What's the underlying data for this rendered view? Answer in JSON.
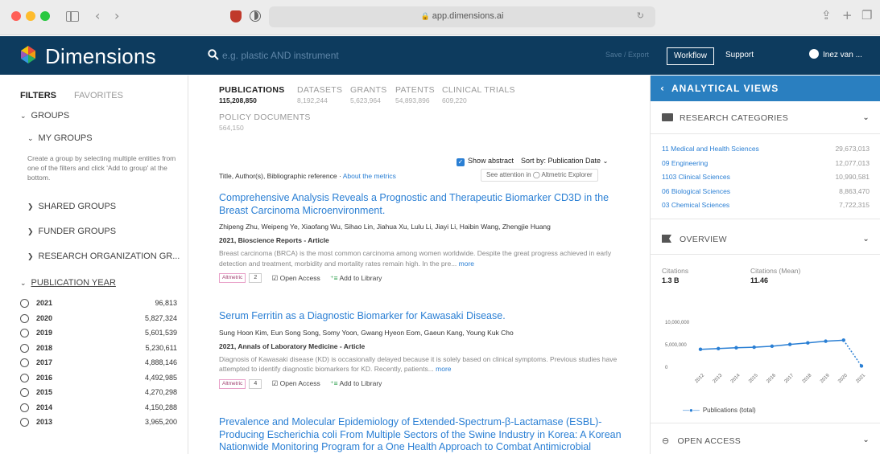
{
  "browser": {
    "url": "app.dimensions.ai",
    "nav_back": "‹",
    "nav_forward": "›"
  },
  "header": {
    "brand": "Dimensions",
    "search_placeholder": "e.g. plastic AND instrument",
    "save_export": "Save / Export",
    "workflow": "Workflow",
    "support": "Support",
    "user": "Inez van ..."
  },
  "filters": {
    "tab_filters": "FILTERS",
    "tab_favorites": "FAVORITES",
    "groups": "GROUPS",
    "my_groups": "MY GROUPS",
    "my_groups_help": "Create a group by selecting multiple entities from one of the filters and click 'Add to group' at the bottom.",
    "shared_groups": "SHARED GROUPS",
    "funder_groups": "FUNDER GROUPS",
    "research_org_groups": "RESEARCH ORGANIZATION GR...",
    "publication_year": "PUBLICATION YEAR",
    "years": [
      {
        "year": "2021",
        "count": "96,813"
      },
      {
        "year": "2020",
        "count": "5,827,324"
      },
      {
        "year": "2019",
        "count": "5,601,539"
      },
      {
        "year": "2018",
        "count": "5,230,611"
      },
      {
        "year": "2017",
        "count": "4,888,146"
      },
      {
        "year": "2016",
        "count": "4,492,985"
      },
      {
        "year": "2015",
        "count": "4,270,298"
      },
      {
        "year": "2014",
        "count": "4,150,288"
      },
      {
        "year": "2013",
        "count": "3,965,200"
      }
    ]
  },
  "results": {
    "tabs": [
      {
        "label": "PUBLICATIONS",
        "count": "115,208,850"
      },
      {
        "label": "DATASETS",
        "count": "8,192,244"
      },
      {
        "label": "GRANTS",
        "count": "5,623,964"
      },
      {
        "label": "PATENTS",
        "count": "54,893,896"
      },
      {
        "label": "CLINICAL TRIALS",
        "count": "609,220"
      }
    ],
    "policy_label": "POLICY DOCUMENTS",
    "policy_count": "564,150",
    "show_abstract": "Show abstract",
    "sort_by": "Sort by: Publication Date",
    "meta_prefix": "Title, Author(s), Bibliographic reference · ",
    "meta_link": "About the metrics",
    "attention_btn": "See attention in ◯ Altmetric Explorer",
    "open_access": "Open Access",
    "add_library": "Add to Library",
    "more": "more",
    "altmetric": "Altmetric",
    "publications": [
      {
        "title": "Comprehensive Analysis Reveals a Prognostic and Therapeutic Biomarker CD3D in the Breast Carcinoma Microenvironment.",
        "authors": "Zhipeng Zhu, Weipeng Ye, Xiaofang Wu, Sihao Lin, Jiahua Xu, Lulu Li, Jiayi Li, Haibin Wang, Zhengjie Huang",
        "source": "2021, Bioscience Reports - Article",
        "abstract": "Breast carcinoma (BRCA) is the most common carcinoma among women worldwide. Despite the great progress achieved in early detection and treatment, morbidity and mortality rates remain high. In the pre...",
        "citations": "2"
      },
      {
        "title": "Serum Ferritin as a Diagnostic Biomarker for Kawasaki Disease.",
        "authors": "Sung Hoon Kim, Eun Song Song, Somy Yoon, Gwang Hyeon Eom, Gaeun Kang, Young Kuk Cho",
        "source": "2021, Annals of Laboratory Medicine - Article",
        "abstract": "Diagnosis of Kawasaki disease (KD) is occasionally delayed because it is solely based on clinical symptoms. Previous studies have attempted to identify diagnostic biomarkers for KD. Recently, patients...",
        "citations": "4"
      },
      {
        "title": "Prevalence and Molecular Epidemiology of Extended-Spectrum-β-Lactamase (ESBL)-Producing Escherichia coli From Multiple Sectors of the Swine Industry in Korea: A Korean Nationwide Monitoring Program for a One Health Approach to Combat Antimicrobial"
      }
    ]
  },
  "analytics": {
    "title": "ANALYTICAL VIEWS",
    "research_categories": "RESEARCH CATEGORIES",
    "categories": [
      {
        "name": "11 Medical and Health Sciences",
        "value": "29,673,013"
      },
      {
        "name": "09 Engineering",
        "value": "12,077,013"
      },
      {
        "name": "1103 Clinical Sciences",
        "value": "10,990,581"
      },
      {
        "name": "06 Biological Sciences",
        "value": "8,863,470"
      },
      {
        "name": "03 Chemical Sciences",
        "value": "7,722,315"
      }
    ],
    "overview": "OVERVIEW",
    "citations_label": "Citations",
    "citations_value": "1.3 B",
    "citations_mean_label": "Citations (Mean)",
    "citations_mean_value": "11.46",
    "open_access": "OPEN ACCESS",
    "legend": "Publications (total)"
  },
  "chart_data": {
    "type": "line",
    "x": [
      "2012",
      "2013",
      "2014",
      "2015",
      "2016",
      "2017",
      "2018",
      "2019",
      "2020",
      "2021"
    ],
    "series": [
      {
        "name": "Publications (total)",
        "values": [
          3800000,
          3965200,
          4150288,
          4270298,
          4492985,
          4888146,
          5230611,
          5601539,
          5827324,
          96813
        ]
      }
    ],
    "ylim": [
      0,
      10000000
    ],
    "yticks": [
      "10,000,000",
      "5,000,000",
      "0"
    ],
    "colors": {
      "line": "#2a7fd4"
    }
  },
  "colors": {
    "appbar": "#0d3b5e",
    "accent": "#2a7fd4",
    "analytics_header": "#2a7fc0"
  }
}
